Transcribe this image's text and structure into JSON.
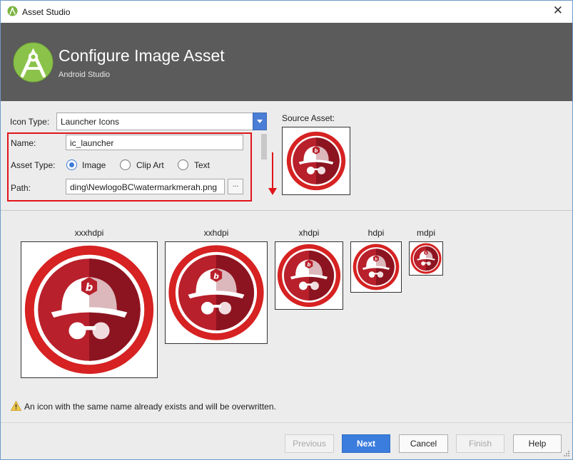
{
  "window": {
    "title": "Asset Studio",
    "close_glyph": "✕"
  },
  "header": {
    "title": "Configure Image Asset",
    "subtitle": "Android Studio"
  },
  "form": {
    "icon_type_label": "Icon Type:",
    "icon_type_value": "Launcher Icons",
    "name_label": "Name:",
    "name_value": "ic_launcher",
    "asset_type_label": "Asset Type:",
    "asset_options": [
      {
        "label": "Image",
        "selected": true
      },
      {
        "label": "Clip Art",
        "selected": false
      },
      {
        "label": "Text",
        "selected": false
      }
    ],
    "path_label": "Path:",
    "path_value": "ding\\NewlogoBC\\watermarkmerah.png",
    "browse_label": "..."
  },
  "source_asset": {
    "label": "Source Asset:"
  },
  "densities": [
    {
      "label": "xxxhdpi"
    },
    {
      "label": "xxhdpi"
    },
    {
      "label": "xhdpi"
    },
    {
      "label": "hdpi"
    },
    {
      "label": "mdpi"
    }
  ],
  "warning": {
    "text": "An icon with the same name already exists and will be overwritten."
  },
  "buttons": {
    "previous": "Previous",
    "next": "Next",
    "cancel": "Cancel",
    "finish": "Finish",
    "help": "Help"
  },
  "icon_glyph": {
    "letter": "b"
  },
  "colors": {
    "accent": "#3b7ddd",
    "highlight_red": "#e0141a",
    "icon_red": "#c8102e",
    "header_bg": "#5b5b5b"
  }
}
